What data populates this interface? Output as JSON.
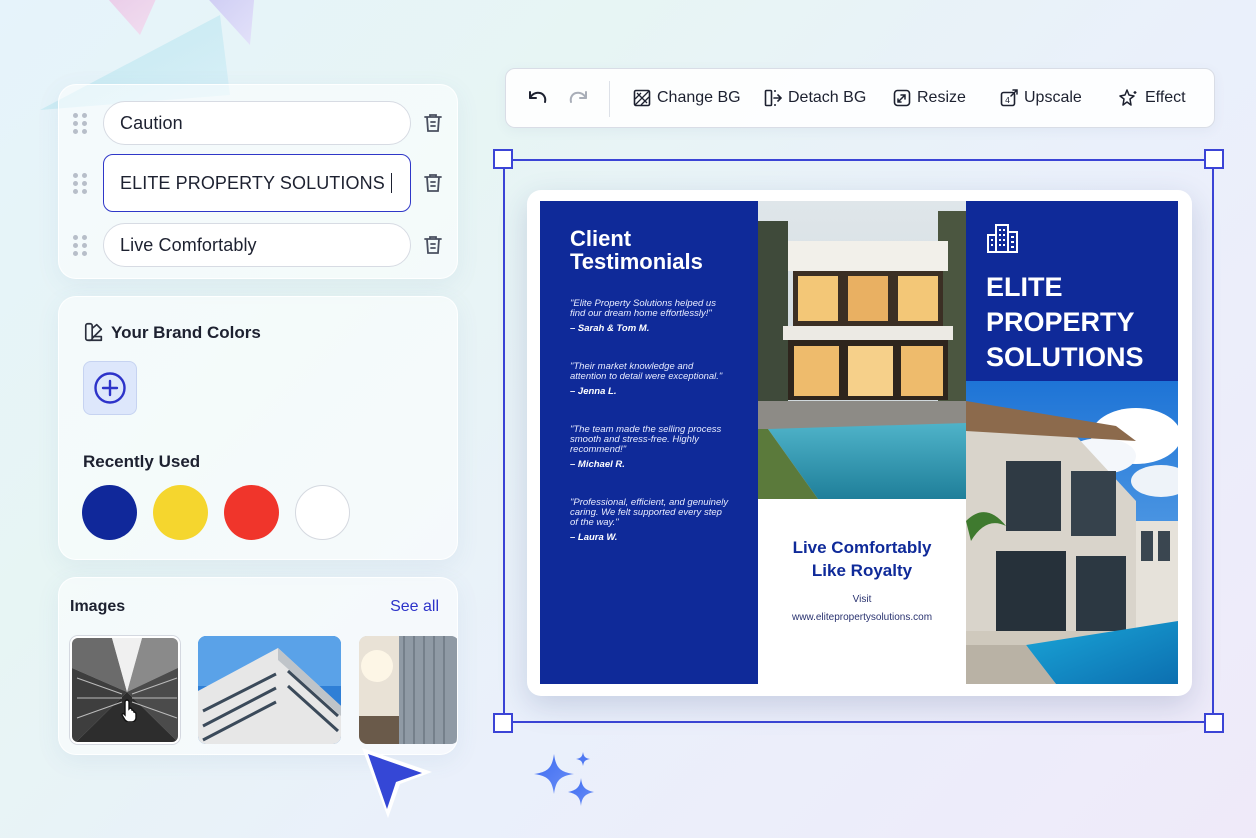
{
  "text_fields": [
    {
      "value": "Caution"
    },
    {
      "value": "ELITE PROPERTY SOLUTIONS"
    },
    {
      "value": "Live Comfortably"
    }
  ],
  "brand_colors": {
    "title": "Your Brand Colors",
    "recently_used_title": "Recently Used",
    "recent_colors": [
      "#10289a",
      "#f5d62e",
      "#f0352b",
      "#ffffff"
    ]
  },
  "images": {
    "title": "Images",
    "see_all": "See all"
  },
  "toolbar": {
    "change_bg": "Change BG",
    "detach_bg": "Detach BG",
    "resize": "Resize",
    "upscale": "Upscale",
    "effect": "Effect"
  },
  "brochure": {
    "testimonials_title_line1": "Client",
    "testimonials_title_line2": "Testimonials",
    "testimonials": [
      {
        "quote": "\"Elite Property Solutions helped us find our dream home effortlessly!\"",
        "author": "– Sarah & Tom M."
      },
      {
        "quote": "\"Their market knowledge and attention to detail were exceptional.\"",
        "author": "– Jenna L."
      },
      {
        "quote": "\"The team made the selling process smooth and stress-free. Highly recommend!\"",
        "author": "– Michael R."
      },
      {
        "quote": "\"Professional, efficient, and genuinely caring. We felt supported every step of the way.\"",
        "author": "– Laura W."
      }
    ],
    "tagline_line1": "Live Comfortably",
    "tagline_line2": "Like Royalty",
    "visit_label": "Visit",
    "website": "www.elitepropertysolutions.com",
    "brand_line1": "ELITE",
    "brand_line2": "PROPERTY",
    "brand_line3": "SOLUTIONS",
    "brand_color": "#0f2a99"
  },
  "accent_color": "#3b44d6"
}
